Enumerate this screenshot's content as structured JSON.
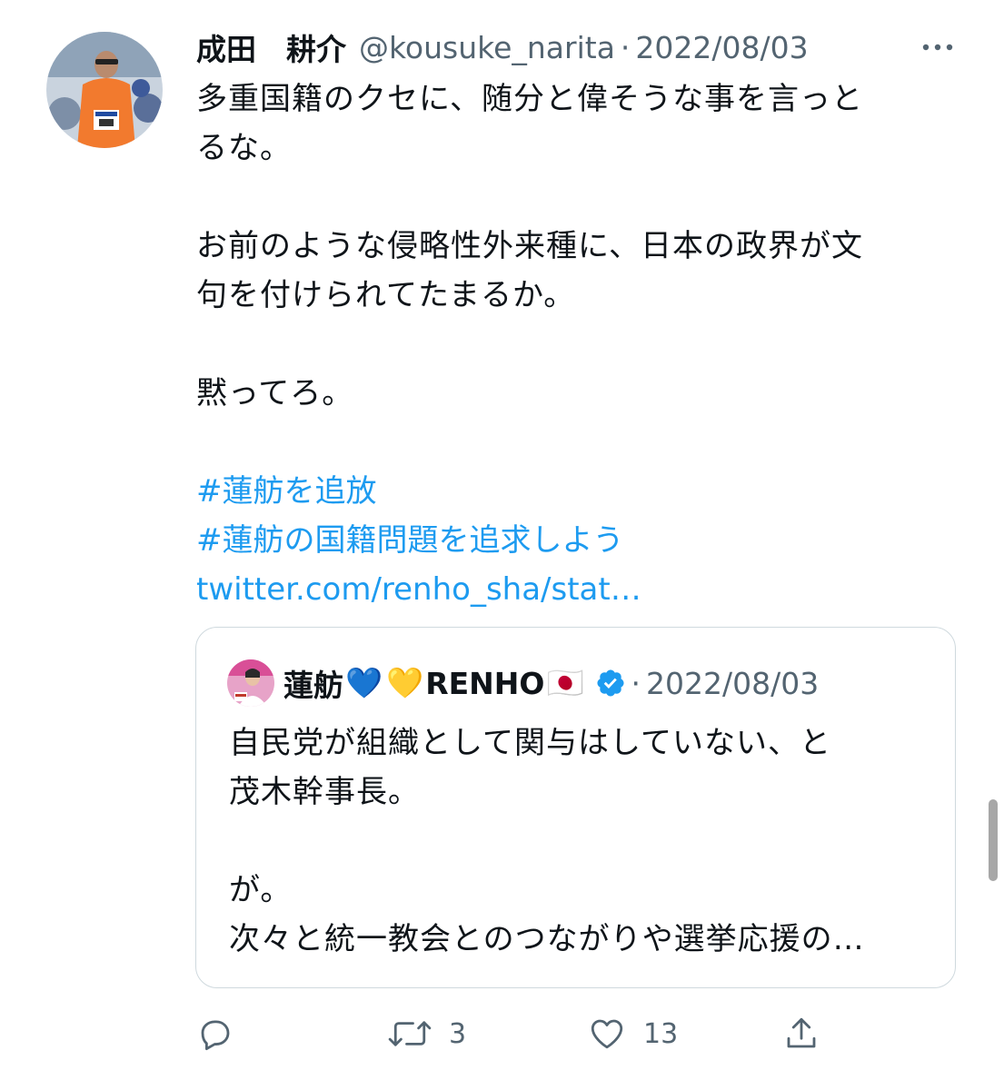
{
  "tweet": {
    "author_name": "成田　耕介",
    "handle": "@kousuke_narita",
    "separator": "·",
    "date": "2022/08/03",
    "lines": [
      "多重国籍のクセに、随分と偉そうな事を言っと",
      "るな。",
      "",
      "お前のような侵略性外来種に、日本の政界が文",
      "句を付けられてたまるか。",
      "",
      "黙ってろ。",
      ""
    ],
    "hashtags": [
      "#蓮舫を追放",
      "#蓮舫の国籍問題を追求しよう"
    ],
    "link": "twitter.com/renho_sha/stat…"
  },
  "quote": {
    "name": "蓮舫",
    "emojis": [
      "💙",
      "💛"
    ],
    "name_suffix": "RENHO",
    "flag": "🇯🇵",
    "separator": "·",
    "date": "2022/08/03",
    "lines": [
      "自民党が組織として関与はしていない、と",
      "茂木幹事長。",
      "",
      "が。",
      "次々と統一教会とのつながりや選挙応援の…"
    ]
  },
  "actions": {
    "retweet_count": "3",
    "like_count": "13"
  },
  "icons": {
    "more": "more-icon",
    "reply": "reply-icon",
    "retweet": "retweet-icon",
    "like": "like-icon",
    "share": "share-icon",
    "verified": "verified-badge-icon"
  },
  "colors": {
    "link": "#1d9bf0",
    "secondary_text": "#536471",
    "verified": "#1d9bf0",
    "card_border": "#cfd9de"
  }
}
